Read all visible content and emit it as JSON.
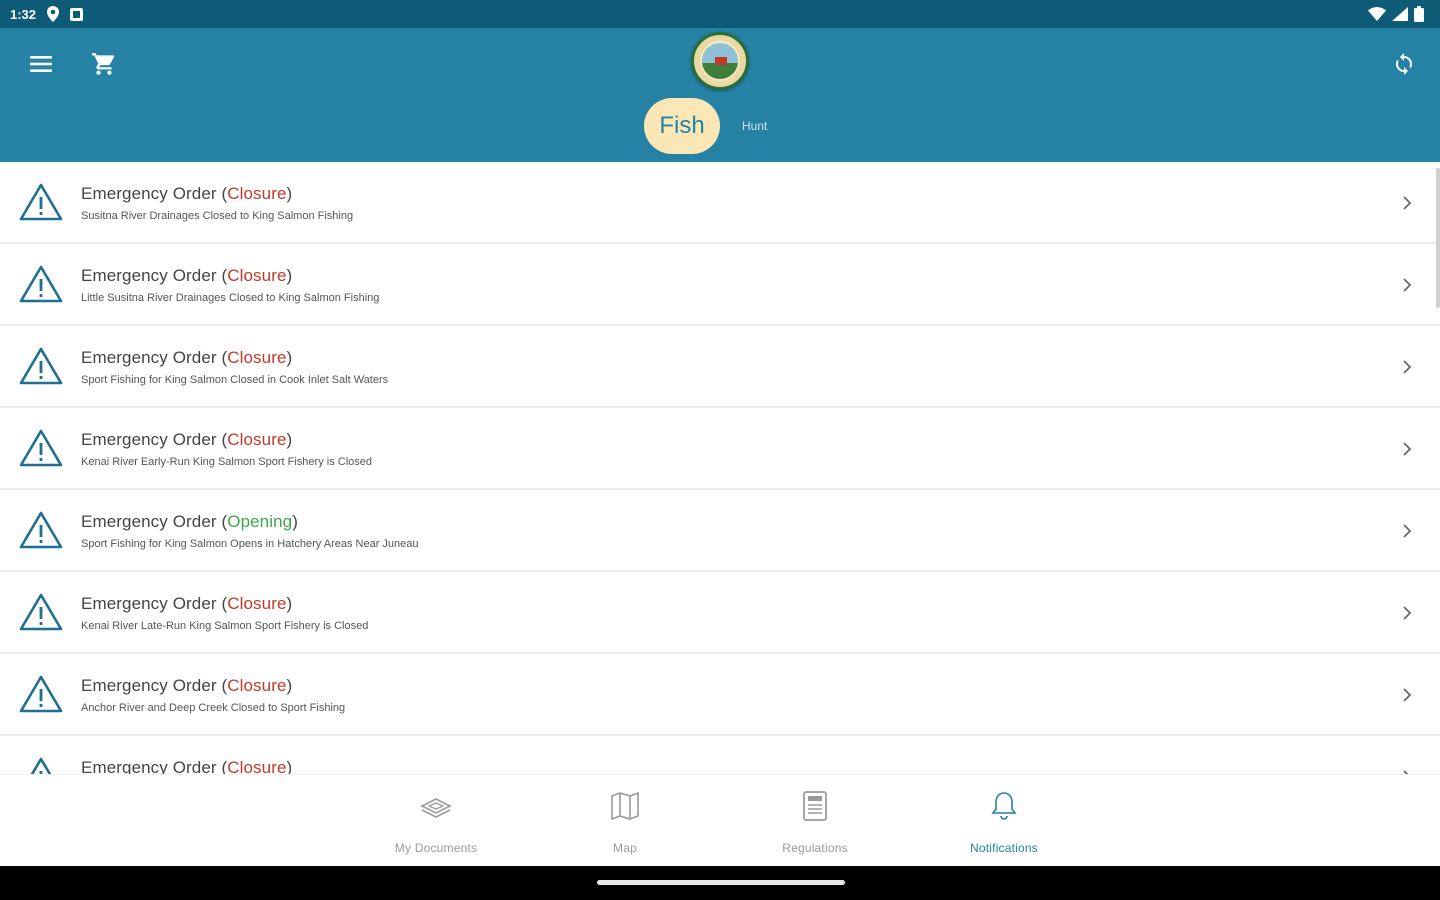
{
  "statusbar": {
    "time": "1:32"
  },
  "tabs": {
    "fish": "Fish",
    "hunt": "Hunt"
  },
  "notifications": [
    {
      "title": "Emergency Order ",
      "status": "Closure",
      "type": "closure",
      "subtitle": "Susitna River Drainages Closed to King Salmon Fishing"
    },
    {
      "title": "Emergency Order ",
      "status": "Closure",
      "type": "closure",
      "subtitle": "Little Susitna River Drainages Closed to King Salmon Fishing"
    },
    {
      "title": "Emergency Order ",
      "status": "Closure",
      "type": "closure",
      "subtitle": "Sport Fishing for King Salmon Closed in Cook Inlet Salt Waters"
    },
    {
      "title": "Emergency Order ",
      "status": "Closure",
      "type": "closure",
      "subtitle": "Kenai River Early-Run King Salmon Sport Fishery is Closed"
    },
    {
      "title": "Emergency Order ",
      "status": "Opening",
      "type": "opening",
      "subtitle": "Sport Fishing for King Salmon Opens in Hatchery Areas Near Juneau"
    },
    {
      "title": "Emergency Order ",
      "status": "Closure",
      "type": "closure",
      "subtitle": "Kenai River Late-Run King Salmon Sport Fishery is Closed"
    },
    {
      "title": "Emergency Order ",
      "status": "Closure",
      "type": "closure",
      "subtitle": "Anchor River and Deep Creek Closed to Sport Fishing"
    },
    {
      "title": "Emergency Order ",
      "status": "Closure",
      "type": "closure",
      "subtitle": ""
    }
  ],
  "bottom_nav": [
    {
      "label": "My Documents",
      "icon": "documents-icon"
    },
    {
      "label": "Map",
      "icon": "map-icon"
    },
    {
      "label": "Regulations",
      "icon": "regulations-icon"
    },
    {
      "label": "Notifications",
      "icon": "bell-icon",
      "active": true
    }
  ],
  "colors": {
    "appbar": "#2582a5",
    "statusbar": "#0e5b78",
    "closure": "#c0392b",
    "opening": "#3ca64a",
    "fish_tab": "#fbe7b5"
  }
}
